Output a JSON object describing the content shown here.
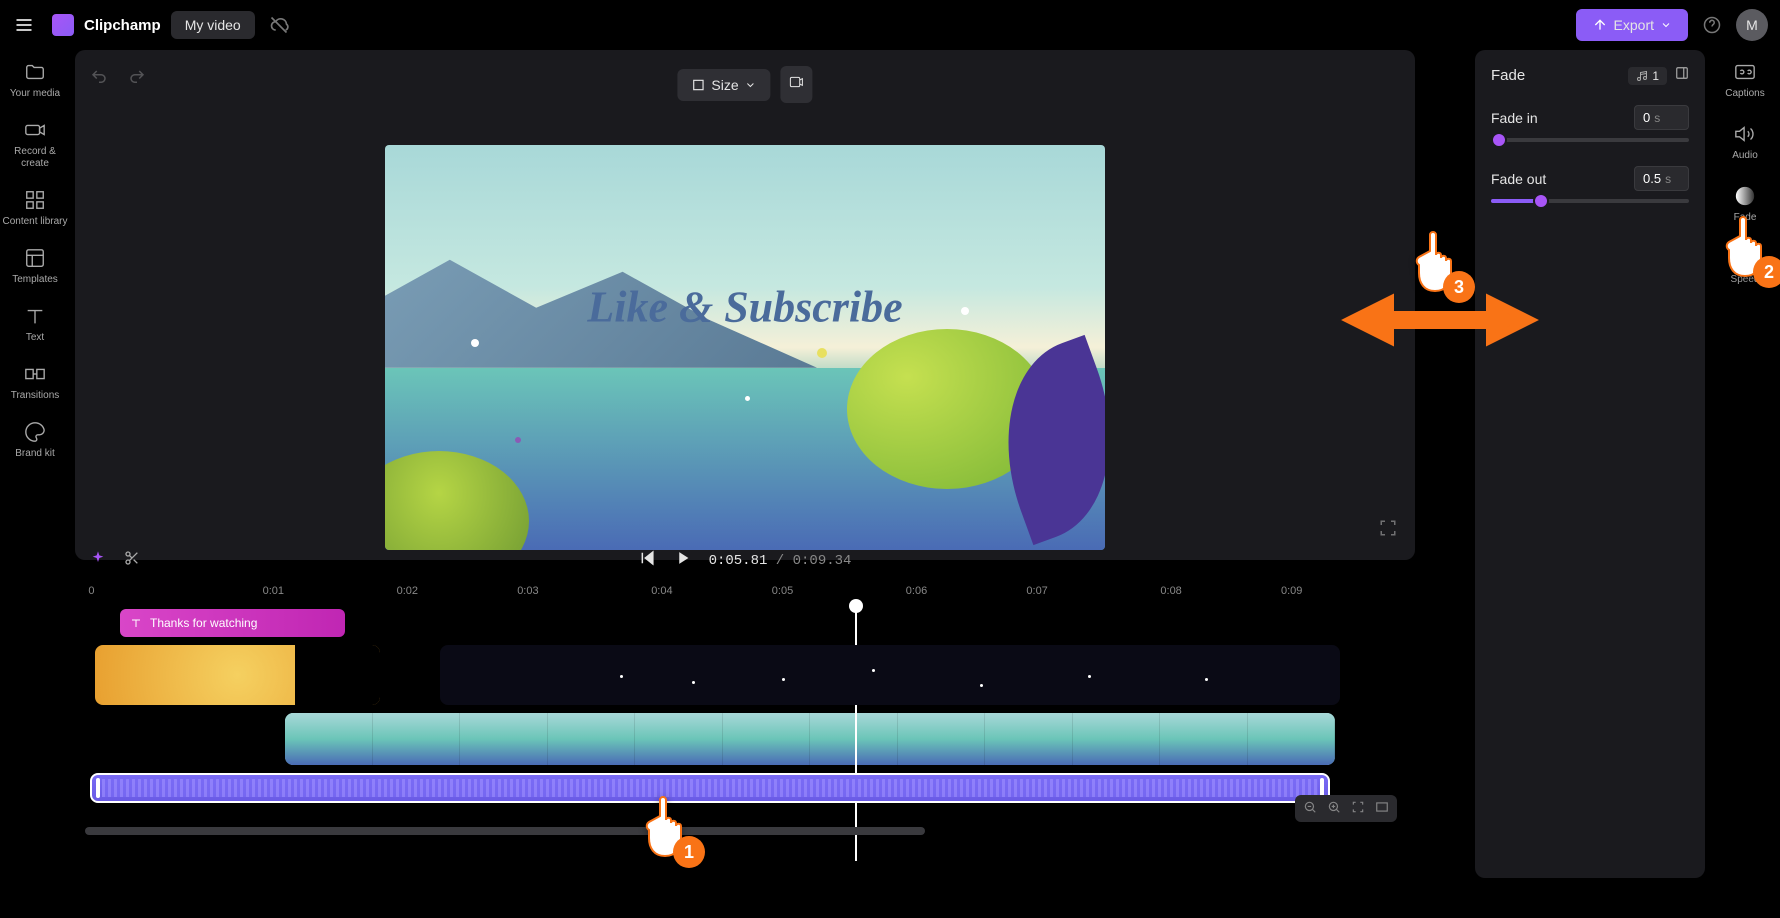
{
  "app": {
    "brand": "Clipchamp",
    "project_name": "My video",
    "export_label": "Export",
    "avatar_letter": "M"
  },
  "left_sidebar": [
    {
      "label": "Your media",
      "icon": "folder"
    },
    {
      "label": "Record & create",
      "icon": "camera"
    },
    {
      "label": "Content library",
      "icon": "library"
    },
    {
      "label": "Templates",
      "icon": "templates"
    },
    {
      "label": "Text",
      "icon": "text"
    },
    {
      "label": "Transitions",
      "icon": "transitions"
    },
    {
      "label": "Brand kit",
      "icon": "palette"
    }
  ],
  "right_sidebar": [
    {
      "label": "Captions",
      "icon": "cc"
    },
    {
      "label": "Audio",
      "icon": "speaker"
    },
    {
      "label": "Fade",
      "icon": "fade"
    },
    {
      "label": "Speed",
      "icon": "speed"
    }
  ],
  "canvas": {
    "size_label": "Size",
    "preview_text": "Like & Subscribe"
  },
  "playback": {
    "current": "0:05.81",
    "total": "0:09.34"
  },
  "ruler": [
    "0",
    "0:01",
    "0:02",
    "0:03",
    "0:04",
    "0:05",
    "0:06",
    "0:07",
    "0:08",
    "0:09"
  ],
  "tracks": {
    "text_clip_label": "Thanks for watching"
  },
  "panel": {
    "title": "Fade",
    "selected_count": "1",
    "fade_in": {
      "label": "Fade in",
      "value": "0",
      "unit": "s",
      "slider_percent": 0
    },
    "fade_out": {
      "label": "Fade out",
      "value": "0.5",
      "unit": "s",
      "slider_percent": 25
    }
  },
  "tutorial": {
    "step1": "1",
    "step2": "2",
    "step3": "3"
  }
}
